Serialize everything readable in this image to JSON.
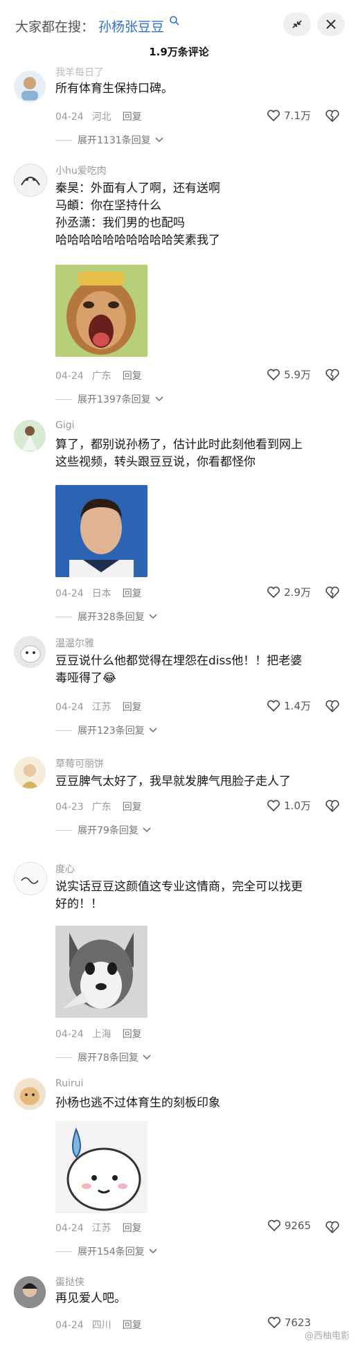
{
  "header": {
    "search_label": "大家都在搜：",
    "search_term": "孙杨张豆豆",
    "comment_count": "1.9万条评论"
  },
  "comments": [
    {
      "username": "我羊每日了",
      "text": [
        "所有体育生保持口碑。"
      ],
      "date": "04-24",
      "location": "河北",
      "reply": "回复",
      "likes": "7.1万",
      "expand": "展开1131条回复"
    },
    {
      "username": "小hu爱吃肉",
      "text": [
        "秦昊：外面有人了啊，还有送啊",
        "马頔：你在坚持什么",
        "孙丞潇：我们男的也配吗",
        "哈哈哈哈哈哈哈哈哈哈笑素我了"
      ],
      "date": "04-24",
      "location": "广东",
      "reply": "回复",
      "likes": "5.9万",
      "expand": "展开1397条回复"
    },
    {
      "username": "Gigi",
      "text": [
        "算了，都别说孙杨了，估计此时此刻他看到网上",
        "这些视频，转头跟豆豆说，你看都怪你"
      ],
      "date": "04-24",
      "location": "日本",
      "reply": "回复",
      "likes": "2.9万",
      "expand": "展开328条回复"
    },
    {
      "username": "温温尔雅",
      "text": [
        "豆豆说什么他都觉得在埋怨在diss他！！把老婆",
        "毒哑得了😂"
      ],
      "date": "04-24",
      "location": "江苏",
      "reply": "回复",
      "likes": "1.4万",
      "expand": "展开123条回复"
    },
    {
      "username": "草莓可丽饼",
      "text": [
        "豆豆脾气太好了，我早就发脾气甩脸子走人了"
      ],
      "date": "04-23",
      "location": "广东",
      "reply": "回复",
      "likes": "1.0万",
      "expand": "展开79条回复"
    },
    {
      "username": "度心",
      "text": [
        "说实话豆豆这颜值这专业这情商，完全可以找更",
        "好的！！"
      ],
      "date": "04-24",
      "location": "上海",
      "reply": "回复",
      "likes": "",
      "expand": "展开78条回复"
    },
    {
      "username": "Ruirui",
      "text": [
        "孙杨也逃不过体育生的刻板印象"
      ],
      "date": "04-24",
      "location": "江苏",
      "reply": "回复",
      "likes": "9265",
      "expand": "展开154条回复"
    },
    {
      "username": "蛋挞侠",
      "text": [
        "再见爱人吧。"
      ],
      "date": "04-24",
      "location": "四川",
      "reply": "回复",
      "likes": "7623",
      "expand": ""
    }
  ],
  "watermark": "@西柚电影",
  "colors": {
    "accent": "#2f6fd6",
    "meta": "#9a9a9a"
  }
}
